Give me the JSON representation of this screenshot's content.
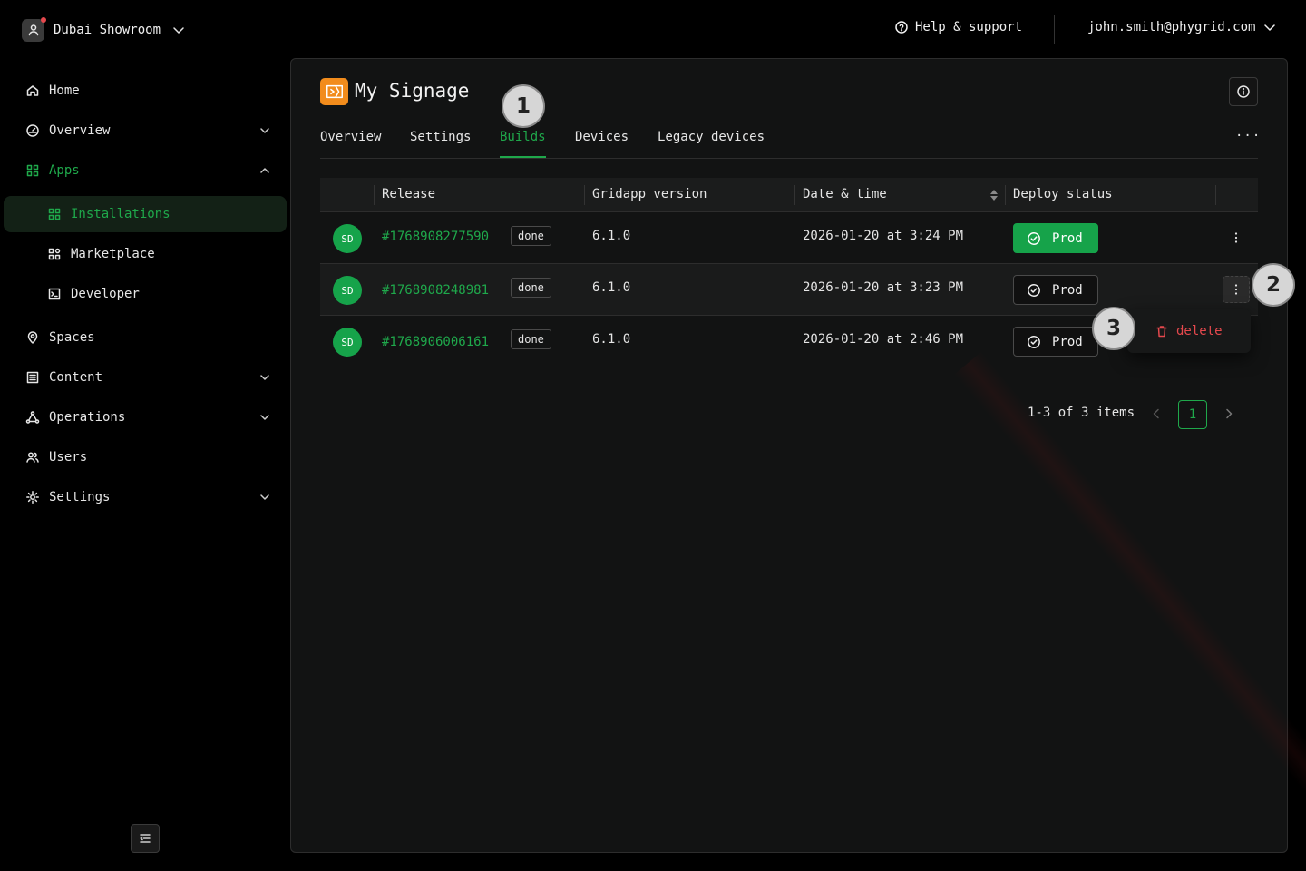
{
  "header": {
    "org_name": "Dubai Showroom",
    "help_label": "Help & support",
    "user_email": "john.smith@phygrid.com"
  },
  "sidebar": {
    "items": [
      {
        "label": "Home",
        "icon": "home-icon"
      },
      {
        "label": "Overview",
        "icon": "gauge-icon"
      },
      {
        "label": "Apps",
        "icon": "apps-grid-icon"
      },
      {
        "label": "Spaces",
        "icon": "map-pin-icon"
      },
      {
        "label": "Content",
        "icon": "document-list-icon"
      },
      {
        "label": "Operations",
        "icon": "network-icon"
      },
      {
        "label": "Users",
        "icon": "users-icon"
      },
      {
        "label": "Settings",
        "icon": "gear-icon"
      }
    ],
    "apps_children": [
      {
        "label": "Installations",
        "icon": "grid-icon"
      },
      {
        "label": "Marketplace",
        "icon": "marketplace-icon"
      },
      {
        "label": "Developer",
        "icon": "terminal-icon"
      }
    ]
  },
  "app": {
    "title": "My Signage",
    "tabs": [
      "Overview",
      "Settings",
      "Builds",
      "Devices",
      "Legacy devices"
    ],
    "more_label": "···"
  },
  "table": {
    "columns": [
      "Release",
      "Gridapp version",
      "Date & time",
      "Deploy status"
    ],
    "rows": [
      {
        "avatar": "SD",
        "release": "#1768908277590",
        "status": "done",
        "version": "6.1.0",
        "datetime": "2026-01-20 at 3:24 PM",
        "deploy": "Prod"
      },
      {
        "avatar": "SD",
        "release": "#1768908248981",
        "status": "done",
        "version": "6.1.0",
        "datetime": "2026-01-20 at 3:23 PM",
        "deploy": "Prod"
      },
      {
        "avatar": "SD",
        "release": "#1768906006161",
        "status": "done",
        "version": "6.1.0",
        "datetime": "2026-01-20 at 2:46 PM",
        "deploy": "Prod"
      }
    ]
  },
  "row_menu": {
    "delete_label": "delete"
  },
  "pagination": {
    "summary": "1-3 of 3 items",
    "current_page": "1"
  },
  "callouts": [
    "1",
    "2",
    "3"
  ],
  "colors": {
    "accent": "#1fa84b",
    "danger": "#e5484d",
    "brand": "#f28c1c",
    "background": "#000000",
    "panel": "#121313"
  }
}
